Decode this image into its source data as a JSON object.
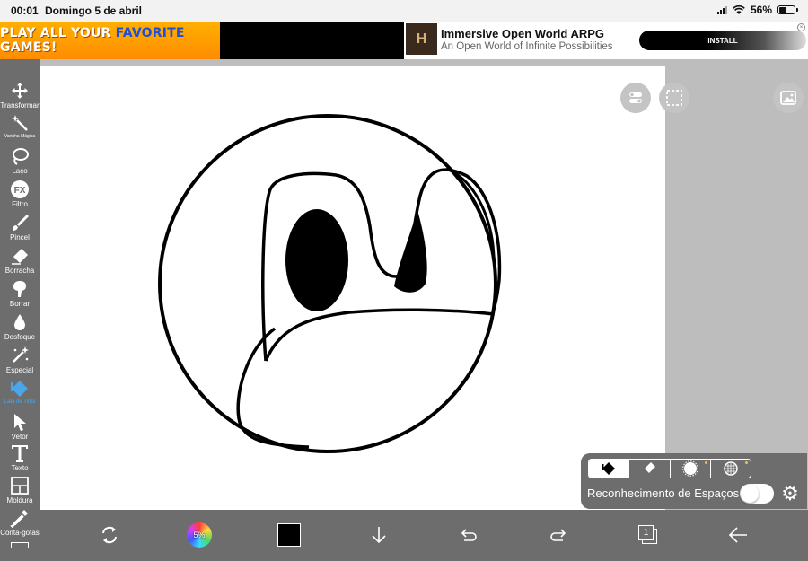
{
  "status_bar": {
    "time": "00:01",
    "date": "Domingo 5 de abril",
    "battery_percent": "56%",
    "battery_level": 0.56
  },
  "ad": {
    "left_text_prefix": "PLAY ALL YOUR ",
    "left_text_highlight": "FAVORITE",
    "left_text_suffix": " GAMES!",
    "title": "Immersive Open World ARPG",
    "subtitle": "An Open World of Infinite Possibilities",
    "install_label": "INSTALL"
  },
  "toolbar": {
    "tools": [
      {
        "label": "Transformar",
        "icon": "move-icon"
      },
      {
        "label": "Varinha Mágica",
        "icon": "magic-wand-icon"
      },
      {
        "label": "Laço",
        "icon": "lasso-icon"
      },
      {
        "label": "Filtro",
        "icon": "fx-icon"
      },
      {
        "label": "Pincel",
        "icon": "brush-icon"
      },
      {
        "label": "Borracha",
        "icon": "eraser-icon"
      },
      {
        "label": "Borrar",
        "icon": "smudge-icon"
      },
      {
        "label": "Desfoque",
        "icon": "blur-icon"
      },
      {
        "label": "Especial",
        "icon": "special-icon"
      },
      {
        "label": "Lata de Tinta",
        "icon": "paint-bucket-icon"
      },
      {
        "label": "Vetor",
        "icon": "vector-icon"
      },
      {
        "label": "Texto",
        "icon": "text-icon"
      },
      {
        "label": "Moldura",
        "icon": "frame-icon"
      },
      {
        "label": "Conta-gotas",
        "icon": "eyedropper-icon"
      }
    ],
    "active_tool": "Lata de Tinta"
  },
  "bottom_bar": {
    "color_wheel_label": "5%",
    "current_color": "#000000",
    "layer_count": "1"
  },
  "fill_panel": {
    "label": "Reconhecimento de Espaços",
    "toggle_on": false
  },
  "colors": {
    "toolbar_bg": "#6d6d6d",
    "accent": "#4aa6e8",
    "canvas_bg": "#ffffff"
  }
}
